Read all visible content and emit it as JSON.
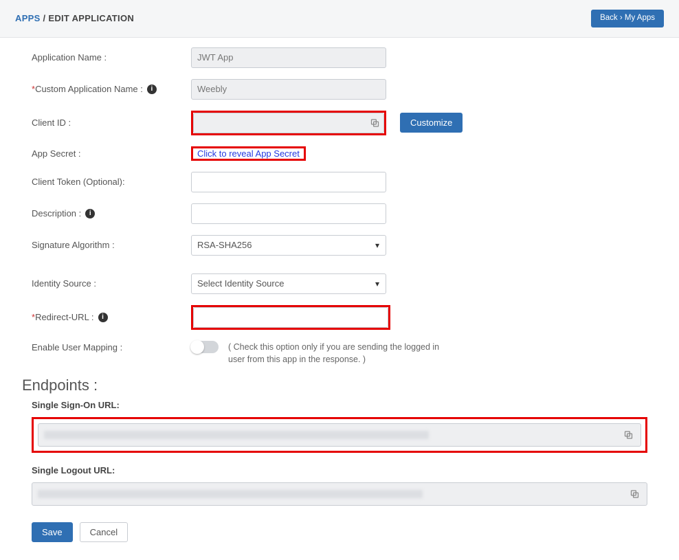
{
  "breadcrumb": {
    "apps_link": "APPS",
    "current": "EDIT APPLICATION"
  },
  "header": {
    "back_btn": "Back › My Apps"
  },
  "form": {
    "app_name": {
      "label": "Application Name :",
      "value": "JWT App"
    },
    "custom_app_name": {
      "label": "Custom Application Name :",
      "value": "Weebly",
      "required": true
    },
    "client_id": {
      "label": "Client ID :",
      "value": ""
    },
    "app_secret": {
      "label": "App Secret :",
      "reveal_text": "Click to reveal App Secret"
    },
    "client_token": {
      "label": "Client Token (Optional):",
      "value": ""
    },
    "description": {
      "label": "Description :",
      "value": ""
    },
    "sig_algo": {
      "label": "Signature Algorithm :",
      "value": "RSA-SHA256"
    },
    "identity_source": {
      "label": "Identity Source :",
      "value": "Select Identity Source"
    },
    "redirect_url": {
      "label": "Redirect-URL :",
      "value": "",
      "required": true
    },
    "user_mapping": {
      "label": "Enable User Mapping :",
      "caption": "( Check this option only if you are sending the logged in user from this app in the response. )",
      "on": false
    },
    "customize_btn": "Customize"
  },
  "endpoints": {
    "heading": "Endpoints :",
    "sso": {
      "label": "Single Sign-On URL:",
      "value": ""
    },
    "slo": {
      "label": "Single Logout URL:",
      "value": ""
    }
  },
  "actions": {
    "save": "Save",
    "cancel": "Cancel"
  }
}
